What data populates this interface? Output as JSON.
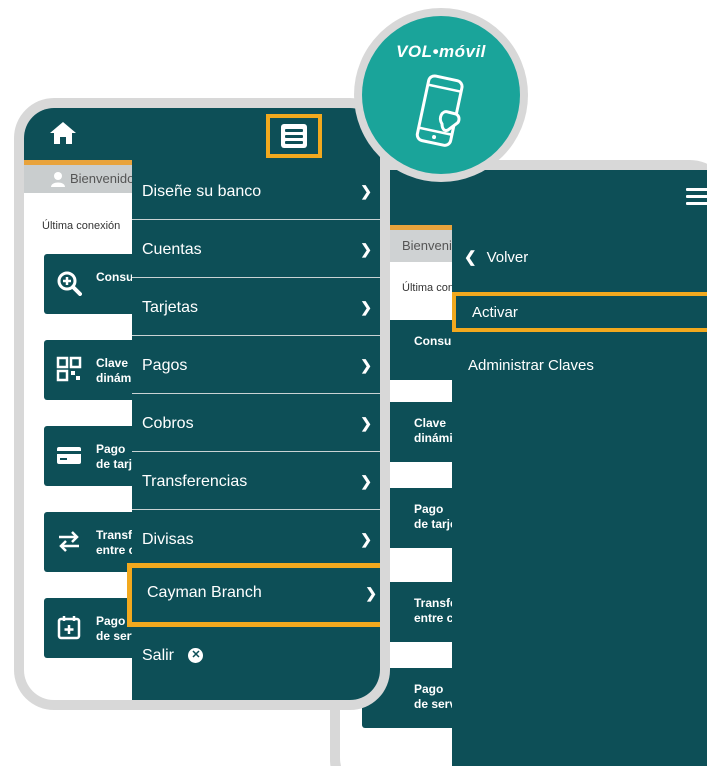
{
  "badge": {
    "brand": "VOL•móvil"
  },
  "phone1": {
    "welcome": "Bienvenido",
    "last_connection": "Última conexión",
    "cards": [
      {
        "icon": "magnifier-plus-icon",
        "line1": "Consultas",
        "line2": ""
      },
      {
        "icon": "qr-code-icon",
        "line1": "Clave",
        "line2": "dinámica"
      },
      {
        "icon": "credit-card-icon",
        "line1": "Pago",
        "line2": "de tarjetas"
      },
      {
        "icon": "transfer-arrows-icon",
        "line1": "Transferencias",
        "line2": "entre cuentas"
      },
      {
        "icon": "calendar-plus-icon",
        "line1": "Pago",
        "line2": "de servicios"
      }
    ],
    "menu": [
      {
        "label": "Diseñe su banco"
      },
      {
        "label": "Cuentas"
      },
      {
        "label": "Tarjetas"
      },
      {
        "label": "Pagos"
      },
      {
        "label": "Cobros"
      },
      {
        "label": "Transferencias"
      },
      {
        "label": "Divisas"
      },
      {
        "label": "Cayman Branch"
      },
      {
        "label": "Salir"
      }
    ]
  },
  "phone2": {
    "welcome": "Bienvenido",
    "last_connection": "Última conexión",
    "cards": [
      {
        "line1": "Consultas",
        "line2": ""
      },
      {
        "line1": "Clave",
        "line2": "dinámica"
      },
      {
        "line1": "Pago",
        "line2": "de tarjetas"
      },
      {
        "line1": "Transferencias",
        "line2": "entre cuentas"
      },
      {
        "line1": "Pago",
        "line2": "de servicios"
      }
    ],
    "menu": {
      "back": "Volver",
      "items": [
        {
          "label": "Activar"
        },
        {
          "label": "Administrar Claves"
        }
      ]
    }
  },
  "colors": {
    "primary": "#0d4f57",
    "highlight": "#f2a91e",
    "accent_bar": "#e8a33c",
    "badge": "#1aa49a",
    "frame": "#d8d8d8"
  }
}
